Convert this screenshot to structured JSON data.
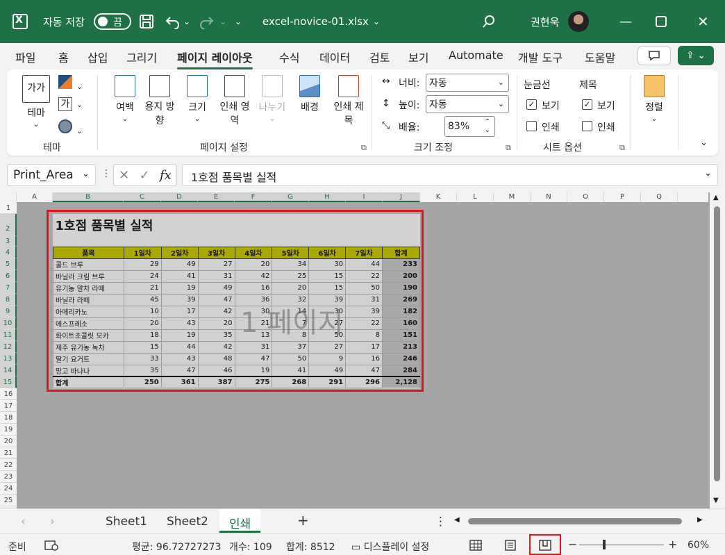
{
  "titlebar": {
    "autosave_label": "자동 저장",
    "autosave_state": "끔",
    "filename": "excel-novice-01.xlsx",
    "user_name": "권현욱"
  },
  "tabs": [
    "파일",
    "홈",
    "삽입",
    "그리기",
    "페이지 레이아웃",
    "수식",
    "데이터",
    "검토",
    "보기",
    "Automate",
    "개발 도구",
    "도움말"
  ],
  "active_tab": "페이지 레이아웃",
  "ribbon": {
    "theme_group": "테마",
    "theme_button": "테마",
    "theme_icon_text": "가가",
    "font_icon_text": "가",
    "page_setup_group": "페이지 설정",
    "margins": "여백",
    "orientation": "용지 방향",
    "size": "크기",
    "print_area": "인쇄 영역",
    "breaks": "나누기",
    "background": "배경",
    "print_titles": "인쇄 제목",
    "scale_group": "크기 조정",
    "width_label": "너비:",
    "width_value": "자동",
    "height_label": "높이:",
    "height_value": "자동",
    "scale_label": "배율:",
    "scale_value": "83%",
    "sheet_options_group": "시트 옵션",
    "gridlines": "눈금선",
    "headings": "제목",
    "view": "보기",
    "print": "인쇄",
    "arrange": "정렬"
  },
  "formula_bar": {
    "name_box": "Print_Area",
    "fx": "fx",
    "formula": "1호점 품목별 실적"
  },
  "columns": [
    "A",
    "B",
    "C",
    "D",
    "E",
    "F",
    "G",
    "H",
    "I",
    "J",
    "K",
    "L",
    "M",
    "N",
    "O",
    "P",
    "Q"
  ],
  "rows": [
    "1",
    "2",
    "3",
    "4",
    "5",
    "6",
    "7",
    "8",
    "9",
    "10",
    "11",
    "12",
    "13",
    "14",
    "15",
    "16",
    "17",
    "18",
    "19",
    "20",
    "21",
    "22",
    "23",
    "24",
    "25"
  ],
  "sheet": {
    "title": "1호점 품목별 실적",
    "headers": [
      "품목",
      "1일차",
      "2일차",
      "3일차",
      "4일차",
      "5일차",
      "6일차",
      "7일차",
      "합계"
    ],
    "data": [
      [
        "콜드 브루",
        "29",
        "49",
        "27",
        "20",
        "34",
        "30",
        "44",
        "233"
      ],
      [
        "바닐라 크림 브루",
        "24",
        "41",
        "31",
        "42",
        "25",
        "15",
        "22",
        "200"
      ],
      [
        "유기농 말차 라떼",
        "21",
        "19",
        "49",
        "16",
        "20",
        "15",
        "50",
        "190"
      ],
      [
        "바닐라 라떼",
        "45",
        "39",
        "47",
        "36",
        "32",
        "39",
        "31",
        "269"
      ],
      [
        "아메리카노",
        "10",
        "17",
        "42",
        "30",
        "14",
        "30",
        "39",
        "182"
      ],
      [
        "에스프레소",
        "20",
        "43",
        "20",
        "21",
        "7",
        "27",
        "22",
        "160"
      ],
      [
        "화이트초콜릿 모카",
        "18",
        "19",
        "35",
        "13",
        "8",
        "50",
        "8",
        "151"
      ],
      [
        "제주 유기농 녹차",
        "15",
        "44",
        "42",
        "31",
        "37",
        "27",
        "17",
        "213"
      ],
      [
        "딸기 요거트",
        "33",
        "43",
        "48",
        "47",
        "50",
        "9",
        "16",
        "246"
      ],
      [
        "망고 바나나",
        "35",
        "47",
        "46",
        "19",
        "41",
        "49",
        "47",
        "284"
      ]
    ],
    "total": [
      "합계",
      "250",
      "361",
      "387",
      "275",
      "268",
      "291",
      "296",
      "2,128"
    ],
    "page_watermark": "1 페이지"
  },
  "sheet_tabs": [
    "Sheet1",
    "Sheet2",
    "인쇄"
  ],
  "active_sheet": "인쇄",
  "statusbar": {
    "ready": "준비",
    "average": "평균: 96.72727273",
    "count": "개수: 109",
    "sum": "합계: 8512",
    "display_settings": "디스플레이 설정",
    "zoom": "60%"
  },
  "colors": {
    "excel_green": "#1e7145",
    "header_fill": "#cfcf00",
    "highlight_red": "#e0161a"
  }
}
